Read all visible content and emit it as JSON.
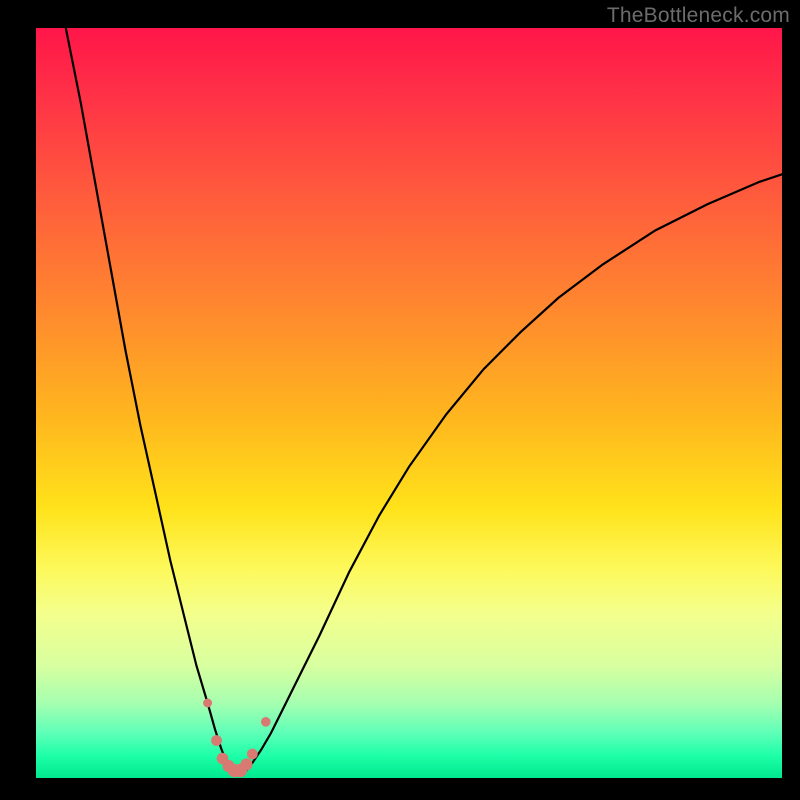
{
  "watermark": "TheBottleneck.com",
  "colors": {
    "page_bg": "#000000",
    "gradient_top": "#ff1649",
    "gradient_mid": "#ffe21a",
    "gradient_bottom": "#00e98f",
    "curve": "#000000",
    "dots": "#d87a72"
  },
  "chart_data": {
    "type": "line",
    "title": "",
    "xlabel": "",
    "ylabel": "",
    "xlim": [
      0,
      100
    ],
    "ylim": [
      0,
      100
    ],
    "grid": false,
    "series": [
      {
        "name": "bottleneck-curve",
        "x": [
          4,
          6,
          8,
          10,
          12,
          14,
          16,
          18,
          20,
          21.5,
          23,
          24,
          24.8,
          25.5,
          26.5,
          27.3,
          28.2,
          29,
          30.2,
          31.5,
          33,
          35,
          38,
          42,
          46,
          50,
          55,
          60,
          65,
          70,
          76,
          83,
          90,
          97,
          100
        ],
        "y": [
          100,
          90,
          79,
          68,
          57,
          47,
          38,
          29,
          21,
          15,
          10,
          6.5,
          4,
          2.2,
          1.2,
          0.8,
          1,
          2,
          3.8,
          6,
          9,
          13,
          19,
          27.5,
          35,
          41.5,
          48.5,
          54.5,
          59.5,
          64,
          68.5,
          73,
          76.5,
          79.5,
          80.5
        ]
      }
    ],
    "markers": [
      {
        "x": 23.0,
        "y": 10.0,
        "r": 1.4
      },
      {
        "x": 24.2,
        "y": 5.0,
        "r": 1.7
      },
      {
        "x": 25.0,
        "y": 2.6,
        "r": 1.8
      },
      {
        "x": 25.8,
        "y": 1.6,
        "r": 1.9
      },
      {
        "x": 26.6,
        "y": 1.0,
        "r": 2.1
      },
      {
        "x": 27.4,
        "y": 1.0,
        "r": 2.1
      },
      {
        "x": 28.2,
        "y": 1.8,
        "r": 1.9
      },
      {
        "x": 29.0,
        "y": 3.2,
        "r": 1.7
      },
      {
        "x": 30.8,
        "y": 7.5,
        "r": 1.5
      }
    ]
  }
}
